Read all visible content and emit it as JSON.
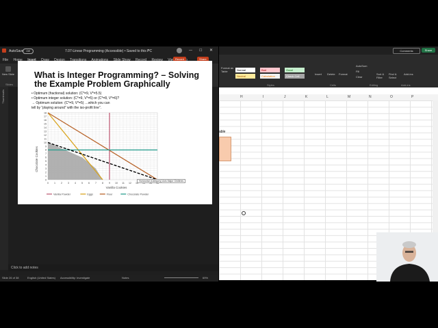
{
  "ppt": {
    "autosave": "AutoSave",
    "toggle": "Off",
    "doc_title": "7.07-Linear Programming (Accessible) • Saved to this PC",
    "search_icon": "search-icon",
    "record_button": "Record",
    "share_button": "Share",
    "menu": [
      "File",
      "Home",
      "Insert",
      "Draw",
      "Design",
      "Transitions",
      "Animations",
      "Slide Show",
      "Record",
      "Review",
      "View",
      "Help"
    ],
    "ribbon": {
      "buttons": [
        "New Slide",
        "Table",
        "Images",
        "Cameo",
        "Shapes",
        "Icons",
        "3D Models",
        "SmartArt",
        "Chart",
        "Links",
        "Comment",
        "Text",
        "Symbols",
        "Media"
      ],
      "groups": [
        "Slides",
        "Tables",
        "Images",
        "Camera",
        "Illustrations",
        "Links",
        "Comments",
        "",
        ""
      ]
    },
    "thumbnails_label": "Thumbnails",
    "notes_placeholder": "Click to add notes",
    "status": {
      "slide": "Slide 26 of 38",
      "language": "English (United States)",
      "accessibility": "Accessibility: Investigate",
      "notes": "Notes",
      "zoom": "69%"
    }
  },
  "slide": {
    "title": "What is Integer Programming? – Solving the Example Problem Graphically",
    "bullets": [
      "•  Optimum (fractional) solution:   (C*=9, V*=5.5)",
      "•  Optimum integer solution:         (C*=9, V*=5) or (C*=8, V*=6)?",
      "     → Optimum solution:                (C*=9, V*=5)   …which you can",
      "                                                    tell by “playing around” with  the iso-profit line”."
    ],
    "tooltip": "Horizontal (Category) Axis Major Gridlines"
  },
  "chart_data": {
    "type": "line",
    "title": "",
    "xlabel": "Vanilla Cookies",
    "ylabel": "Chocolate Cookies",
    "xlim": [
      0,
      16
    ],
    "ylim": [
      0,
      18
    ],
    "x_ticks": [
      0,
      1,
      2,
      3,
      4,
      5,
      6,
      7,
      8,
      9,
      10,
      11,
      12,
      13,
      14,
      15,
      16
    ],
    "y_ticks": [
      0,
      1,
      2,
      3,
      4,
      5,
      6,
      7,
      8,
      9,
      10,
      11,
      12,
      13,
      14,
      15,
      16,
      17,
      18
    ],
    "grid": true,
    "legend_position": "bottom",
    "series": [
      {
        "name": "Vanilla Powder",
        "color": "#c0607a",
        "points": [
          [
            9,
            0
          ],
          [
            9,
            18
          ]
        ]
      },
      {
        "name": "Eggs",
        "color": "#d9a520",
        "points": [
          [
            0,
            18
          ],
          [
            8,
            0
          ]
        ]
      },
      {
        "name": "Flour",
        "color": "#b8642a",
        "points": [
          [
            0,
            18
          ],
          [
            16,
            0
          ]
        ]
      },
      {
        "name": "Chocolate Powder",
        "color": "#2a9d8f",
        "points": [
          [
            0,
            8
          ],
          [
            16,
            8
          ]
        ]
      }
    ],
    "iso_profit": {
      "points": [
        [
          0,
          10
        ],
        [
          16,
          0
        ]
      ],
      "color": "#000000"
    },
    "feasible_region": [
      [
        0,
        0
      ],
      [
        0,
        10
      ],
      [
        5,
        6
      ],
      [
        7,
        3
      ],
      [
        8,
        0
      ]
    ],
    "feasible_color": "#a9a9a9"
  },
  "excel": {
    "cell_styles": [
      {
        "label": "Normal",
        "bg": "#ffffff",
        "fg": "#000000"
      },
      {
        "label": "Bad",
        "bg": "#ffc7ce",
        "fg": "#9c0006"
      },
      {
        "label": "Good",
        "bg": "#c6efce",
        "fg": "#006100"
      },
      {
        "label": "Neutral",
        "bg": "#ffeb9c",
        "fg": "#9c5700"
      },
      {
        "label": "Calculation",
        "bg": "#f2f2f2",
        "fg": "#fa7d00"
      },
      {
        "label": "Check Cell",
        "bg": "#a5a5a5",
        "fg": "#ffffff"
      }
    ],
    "ribbon": [
      "Conditional Formatting",
      "Format as Table",
      "Insert",
      "Delete",
      "Format",
      "AutoSum",
      "Fill",
      "Clear",
      "Sort & Filter",
      "Find & Select",
      "Add-ins"
    ],
    "groups": [
      "Styles",
      "Cells",
      "Editing",
      "Add-ins"
    ],
    "comments_button": "Comments",
    "share_button": "Share",
    "columns": [
      "H",
      "I",
      "J",
      "K",
      "L",
      "M",
      "N",
      "O",
      "P"
    ],
    "cell_text": "able"
  }
}
